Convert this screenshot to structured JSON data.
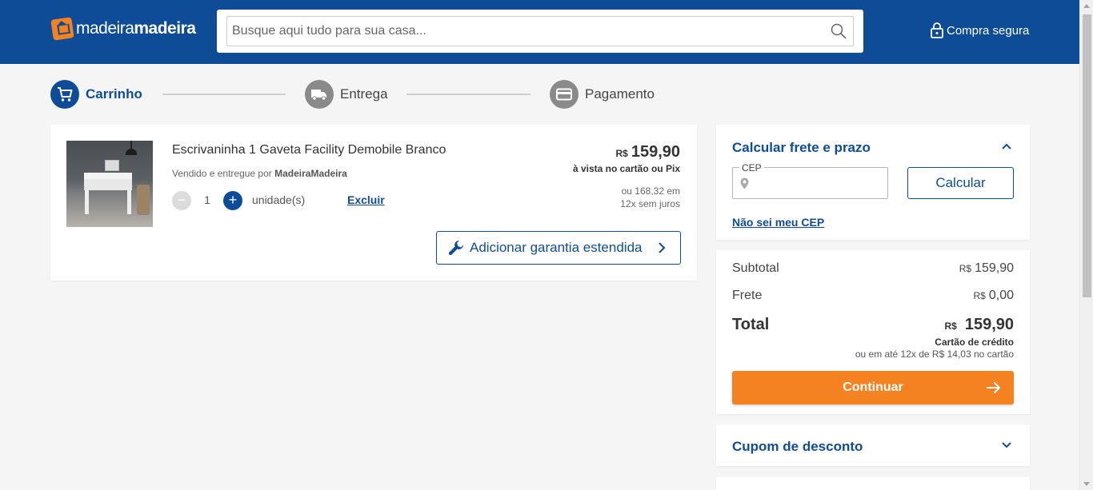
{
  "brand": {
    "logo_light": "madeira",
    "logo_bold": "madeira"
  },
  "header": {
    "search_placeholder": "Busque aqui tudo para sua casa...",
    "secure_label": "Compra segura"
  },
  "steps": [
    {
      "label": "Carrinho",
      "state": "active"
    },
    {
      "label": "Entrega",
      "state": "idle"
    },
    {
      "label": "Pagamento",
      "state": "idle"
    }
  ],
  "cart": {
    "item": {
      "name": "Escrivaninha 1 Gaveta Facility Demobile Branco",
      "seller_prefix": "Vendido e entregue por",
      "seller_name": "MadeiraMadeira",
      "quantity": "1",
      "unit_label": "unidade(s)",
      "remove_label": "Excluir",
      "currency": "R$",
      "price": "159,90",
      "price_note": "à vista no cartão ou Pix",
      "installment_line1": "ou 168,32 em",
      "installment_line2": "12x sem juros"
    },
    "warranty_label": "Adicionar garantia estendida"
  },
  "shipping": {
    "title": "Calcular frete e prazo",
    "cep_label": "CEP",
    "cep_value": "",
    "calc_label": "Calcular",
    "help_link": "Não sei meu CEP"
  },
  "summary": {
    "subtotal_label": "Subtotal",
    "subtotal_currency": "R$",
    "subtotal_value": "159,90",
    "freight_label": "Frete",
    "freight_currency": "R$",
    "freight_value": "0,00",
    "total_label": "Total",
    "total_currency": "R$",
    "total_value": "159,90",
    "total_method": "Cartão de crédito",
    "total_installments": "ou em até 12x de R$ 14,03 no cartão",
    "continue_label": "Continuar"
  },
  "coupon": {
    "title": "Cupom de desconto"
  },
  "colors": {
    "primary": "#0f4c97",
    "accent": "#f58220",
    "background": "#f5f5f5"
  },
  "icons": {
    "search": "search-icon",
    "secure": "lock-icon",
    "cart": "cart-icon",
    "delivery": "truck-icon",
    "payment": "credit-card-icon",
    "warranty": "wrench-icon",
    "cep": "map-pin-icon"
  }
}
